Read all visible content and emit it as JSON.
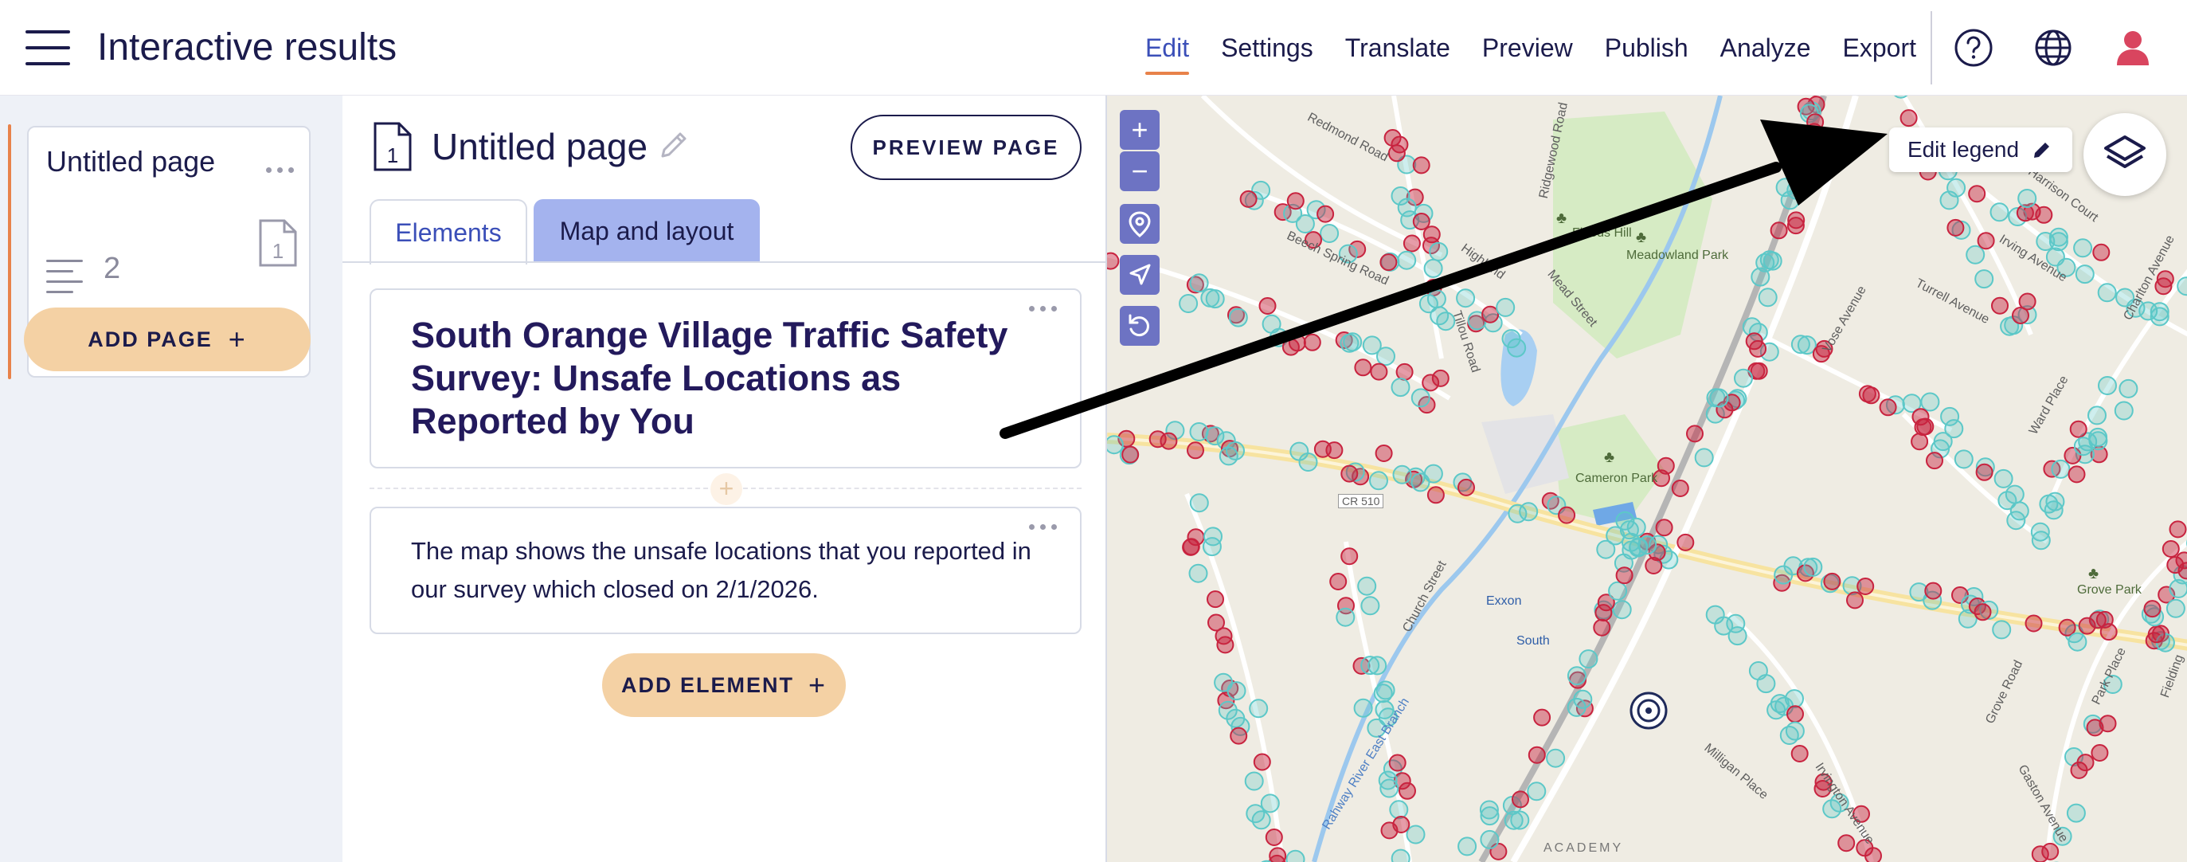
{
  "header": {
    "title": "Interactive results",
    "nav": [
      "Edit",
      "Settings",
      "Translate",
      "Preview",
      "Publish",
      "Analyze",
      "Export"
    ],
    "active_nav": "Edit"
  },
  "pages_panel": {
    "page_card": {
      "title": "Untitled page",
      "element_count": "2"
    },
    "add_page_label": "ADD PAGE"
  },
  "editor": {
    "page_title": "Untitled page",
    "preview_label": "PREVIEW PAGE",
    "tabs": [
      "Elements",
      "Map and layout"
    ],
    "active_tab": "Elements",
    "headline": "South Orange Village Traffic Safety Survey: Unsafe Locations as Reported by You",
    "body": "The map shows the unsafe locations that you reported in our survey which closed on 2/1/2026.",
    "add_element_label": "ADD ELEMENT"
  },
  "map": {
    "zoom_in": "+",
    "zoom_out": "−",
    "edit_legend_label": "Edit legend",
    "labels": {
      "redmond_road": "Redmond Road",
      "ridgewood_road": "Ridgewood Road",
      "floods_hill": "Floods Hill",
      "meadowland_park": "Meadowland Park",
      "beech_spring_road": "Beech Spring Road",
      "highland": "Highland",
      "mead_street": "Mead Street",
      "tillou_road": "Tillou Road",
      "cameron_park": "Cameron Park",
      "cr510": "CR 510",
      "church_street": "Church Street",
      "exxon": "Exxon",
      "south": "South",
      "rahway_river": "Rahway River East Branch",
      "academy": "ACADEMY",
      "harrison_court": "Harrison Court",
      "irving_avenue": "Irving Avenue",
      "charlton_avenue": "Charlton Avenue",
      "turrell_avenue": "Turrell Avenue",
      "vose_avenue": "Vose Avenue",
      "ward_place": "Ward Place",
      "grove_park": "Grove Park",
      "park_place": "Park Place",
      "grove_road": "Grove Road",
      "fielding": "Fielding",
      "milligan_place": "Milligan Place",
      "irvington_avenue": "Irvington Avenue",
      "gaston_avenue": "Gaston Avenue"
    }
  },
  "colors": {
    "accent": "#e8824a",
    "brand": "#1b1b4b",
    "unsafe_marker": "#c8233f",
    "reported_marker": "#5cc8c8",
    "map_control": "#6d73c3"
  }
}
